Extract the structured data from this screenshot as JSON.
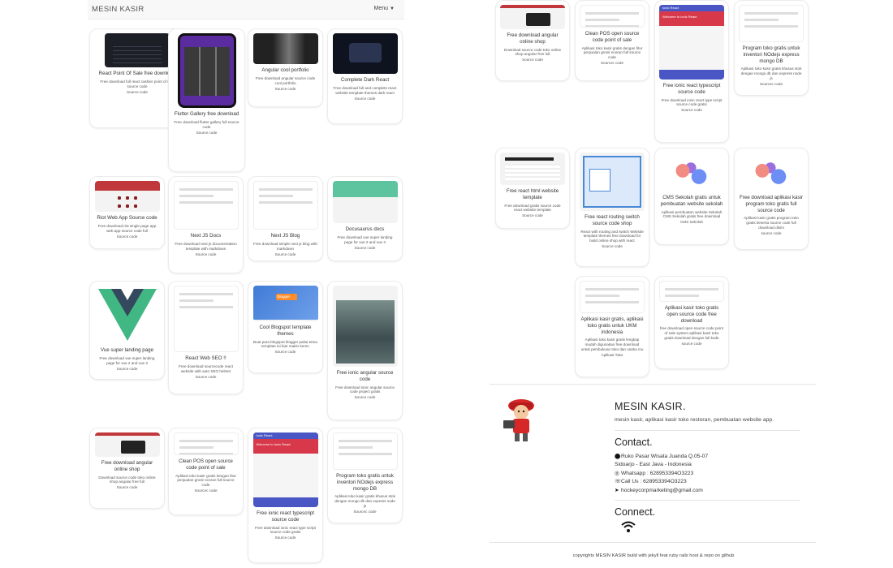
{
  "navbar": {
    "brand": "MESIN KASIR",
    "menu_label": "Menu"
  },
  "cards": [
    {
      "title": "React Point Of Sale free download",
      "desc": "Free download full react cashier point of sale source code",
      "src": "Source code",
      "thumb": "dark"
    },
    {
      "title": "Flutter Gallery free download",
      "desc": "Free download flutter gallery full source code",
      "src": "Source code",
      "thumb": "phone"
    },
    {
      "title": "Angular cool portfolio",
      "desc": "Free download angular source code cool portfolio",
      "src": "Source code",
      "thumb": "portfolio"
    },
    {
      "title": "Complete Dark React",
      "desc": "Free download full and complete react website template themes dark react",
      "src": "Source code",
      "thumb": "darkreact"
    },
    {
      "title": "Riot Web App Source code",
      "desc": "Free download riot single page app web app source code full",
      "src": "Source code",
      "thumb": "red"
    },
    {
      "title": "Next JS Docs",
      "desc": "Free download next js documentation template with markdown",
      "src": "Source code",
      "thumb": "white"
    },
    {
      "title": "Next JS Blog",
      "desc": "Free download simple next js blog with markdown",
      "src": "Source code",
      "thumb": "white"
    },
    {
      "title": "Docusaurus docs",
      "desc": "Free download vue super landing page for vue 2 and vue 3",
      "src": "Source code",
      "thumb": "green"
    },
    {
      "title": "Vue super landing page",
      "desc": "Free download vue super landing page for vue 2 and vue 3",
      "src": "Source code",
      "thumb": "vue"
    },
    {
      "title": "React Web SEO !!",
      "desc": "Free download sourcecode react website with auto SEO helmet",
      "src": "Source code",
      "thumb": "white"
    },
    {
      "title": "Cool Blogspot template themes",
      "desc": "Buat para blogspot blogger pakai tema template ini biar makin keren",
      "src": "Source code",
      "thumb": "blogger"
    },
    {
      "title": "Free ionic angular source code",
      "desc": "Free download ionic angular source code project gratis",
      "src": "Source code",
      "thumb": "photo"
    },
    {
      "title": "Free download angular online shop",
      "desc": "Download source code toko online shop angular free full",
      "src": "Source code",
      "thumb": "laptop"
    },
    {
      "title": "Clean POS open source code point of sale",
      "desc": "Aplikasi toko kasir gratis dengan fitur penjualan grosir eceran full source code",
      "src": "Sourcec code",
      "thumb": "white"
    },
    {
      "title": "Free ionic react typescript source code",
      "desc": "Free download ionic react type script source code gratis",
      "src": "Source code",
      "thumb": "ionic",
      "thumb_title": "Ionic React",
      "thumb_subtitle": "Welcome to Ionic React"
    },
    {
      "title": "Program toko gratis untuk inventori NOdejs express mongo DB",
      "desc": "Aplikasi toko kasir gratis khusus stok dengan mongo db dan express node js",
      "src": "Sourcec code",
      "thumb": "white"
    },
    {
      "title": "Free download angular online shop",
      "desc": "Download source code toko online shop angular free full",
      "src": "Source code",
      "thumb": "laptop"
    },
    {
      "title": "Clean POS open source code point of sale",
      "desc": "Aplikasi toko kasir gratis dengan fitur penjualan grosir eceran full source code",
      "src": "Sourcec code",
      "thumb": "white"
    },
    {
      "title": "Free ionic react typescript source code",
      "desc": "Free download ionic react type script source code gratis",
      "src": "Source code",
      "thumb": "ionic",
      "thumb_title": "Ionic React",
      "thumb_subtitle": "Welcome to Ionic React"
    },
    {
      "title": "Program toko gratis untuk inventori NOdejs express mongo DB",
      "desc": "Aplikasi toko kasir gratis khusus stok dengan mongo db dan express node js",
      "src": "Sourcec code",
      "thumb": "white"
    },
    {
      "title": "Free react html website template",
      "desc": "Free download gratis source code react website template",
      "src": "Source code",
      "thumb": "table"
    },
    {
      "title": "Free react routing switch source code shop",
      "desc": "React with routing and switch Website template themes free download for build online shop with react",
      "src": "Source code",
      "thumb": "routing"
    },
    {
      "title": "CMS Sekolah gratis untuk pembuatan website sekolah",
      "desc": "Aplikasi pembuatan website Sekolah CMS Sekolah gratis free download",
      "src": "CMS Sekolah",
      "thumb": "illus"
    },
    {
      "title": "Free download aplikasi kasir program toko gratis full source code",
      "desc": "Aplikasi kasir gratis program toko gratis beserta source code full download disini",
      "src": "source code",
      "thumb": "illus"
    },
    {
      "title": "Aplikasi kasir gratis, aplikasi toko gratis untuk UKM indonesia",
      "desc": "Aplikasi toko kasir gratis lengkap mudah digunakan free download untuk pembukuan toko dan usaha mu",
      "src": "Aplikasi Toko",
      "thumb": "white"
    },
    {
      "title": "Aplikasi kasir toko gratis open source code free download",
      "desc": "free download open source code point of sale system aplikasi kasir toko gratis download dengan full kode",
      "src": "source code",
      "thumb": "white"
    }
  ],
  "footer": {
    "title": "MESIN KASIR.",
    "tagline": "mesin kasir, aplikasi kasir toko restoran, pembuatan website app.",
    "contact_heading": "Contact.",
    "address1": "Ruko Pasar Wisata Juanda Q.05-07",
    "address2": "Sidoarjo - East Java - Indonesia",
    "whatsapp": "Whatsapp : 628953394O3223",
    "call": "Call Us : 628953394O3223",
    "email": "hockeycorpmarketing@gmail.com",
    "connect_heading": "Connect.",
    "copyright": "copyrights MESIN KASIR build with jekyll feat ruby rails host & repo on github"
  },
  "icons": {
    "location": "map-pin-icon",
    "whatsapp": "whatsapp-icon",
    "phone": "phone-icon",
    "email": "paper-plane-icon",
    "wifi": "wifi-icon",
    "caret": "caret-down-icon"
  }
}
